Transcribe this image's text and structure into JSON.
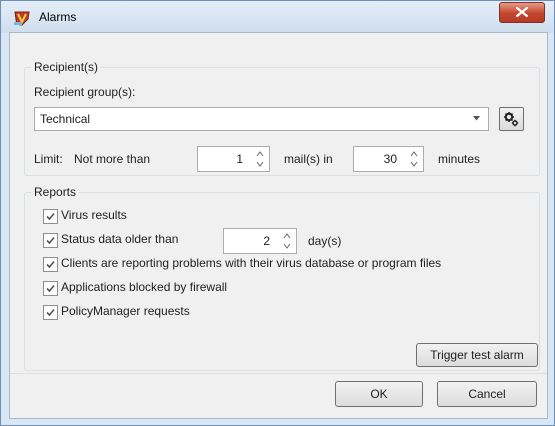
{
  "window": {
    "title": "Alarms",
    "icon": "shield-app-icon",
    "close_icon": "close-icon"
  },
  "recipients": {
    "legend": "Recipient(s)",
    "group_label": "Recipient group(s):",
    "group_value": "Technical",
    "settings_icon": "gears-icon",
    "limit_label": "Limit:",
    "not_more_than_label": "Not more than",
    "mail_count": "1",
    "mails_in_label": "mail(s) in",
    "minutes_value": "30",
    "minutes_label": "minutes"
  },
  "reports": {
    "legend": "Reports",
    "items": [
      {
        "label": "Virus results",
        "checked": true
      },
      {
        "label": "Status data older than",
        "checked": true
      },
      {
        "label": "Clients are reporting problems with their virus database or program files",
        "checked": true
      },
      {
        "label": "Applications blocked by firewall",
        "checked": true
      },
      {
        "label": "PolicyManager requests",
        "checked": true
      }
    ],
    "days_value": "2",
    "days_label": "day(s)",
    "trigger_button": "Trigger test alarm"
  },
  "footer": {
    "ok_label": "OK",
    "cancel_label": "Cancel"
  },
  "colors": {
    "title_bar": "#cfdeee",
    "close_button": "#c4462e",
    "dialog_bg": "#f0f0f0",
    "group_border": "#d5dfe5"
  }
}
